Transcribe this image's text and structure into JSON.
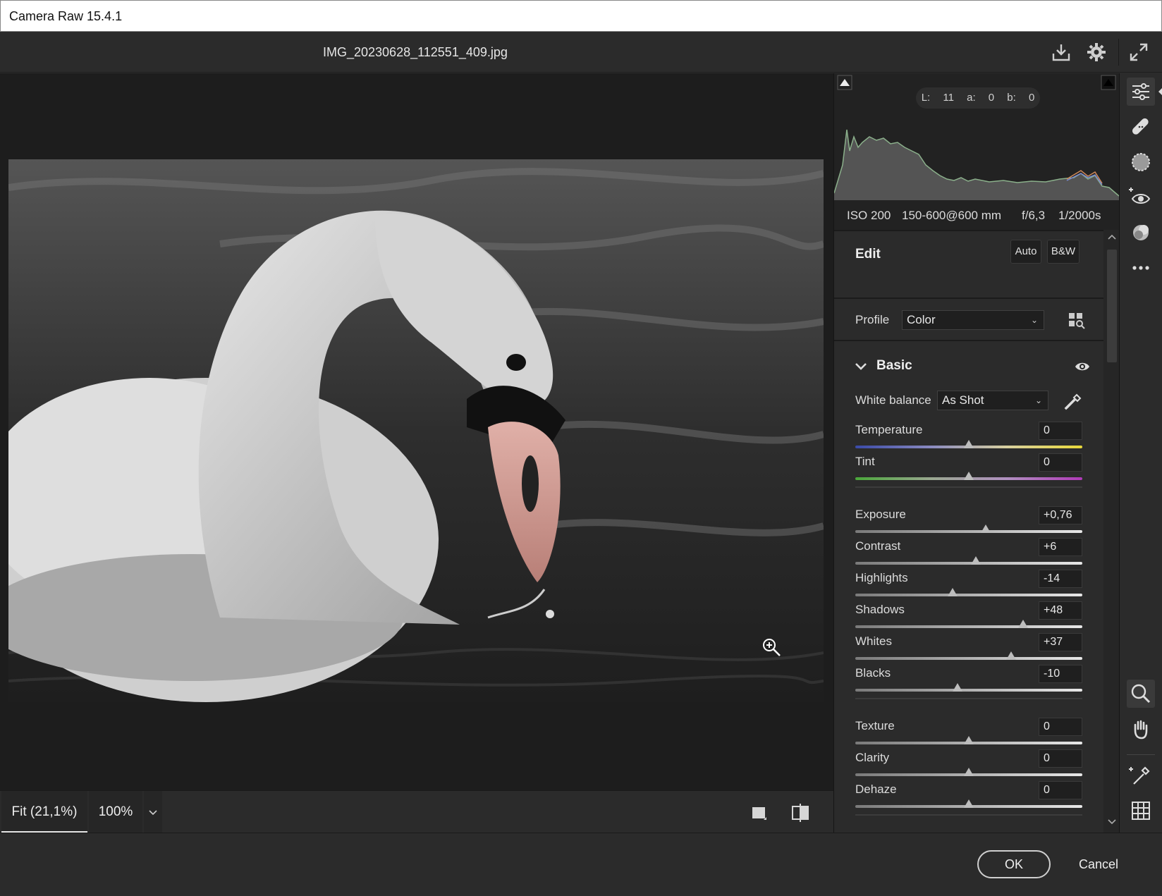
{
  "window": {
    "title": "Camera Raw 15.4.1"
  },
  "header": {
    "filename": "IMG_20230628_112551_409.jpg",
    "icons": [
      "save-icon",
      "settings-gear-icon",
      "fullscreen-icon"
    ]
  },
  "canvas": {
    "zoom_fit_label": "Fit (21,1%)",
    "zoom_100_label": "100%"
  },
  "histogram": {
    "lab_readout": "L: 11   a: 0   b: 0",
    "iso": "ISO 200",
    "lens": "150-600@600 mm",
    "aperture": "f/6,3",
    "shutter": "1/2000s"
  },
  "edit": {
    "title": "Edit",
    "auto_label": "Auto",
    "bw_label": "B&W",
    "profile_label": "Profile",
    "profile_value": "Color"
  },
  "basic": {
    "title": "Basic",
    "white_balance_label": "White balance",
    "white_balance_value": "As Shot",
    "sliders": [
      {
        "label": "Temperature",
        "value": "0",
        "pos": 0.5
      },
      {
        "label": "Tint",
        "value": "0",
        "pos": 0.5
      },
      {
        "label": "Exposure",
        "value": "+0,76",
        "pos": 0.576
      },
      {
        "label": "Contrast",
        "value": "+6",
        "pos": 0.53
      },
      {
        "label": "Highlights",
        "value": "-14",
        "pos": 0.43
      },
      {
        "label": "Shadows",
        "value": "+48",
        "pos": 0.74
      },
      {
        "label": "Whites",
        "value": "+37",
        "pos": 0.685
      },
      {
        "label": "Blacks",
        "value": "-10",
        "pos": 0.45
      },
      {
        "label": "Texture",
        "value": "0",
        "pos": 0.5
      },
      {
        "label": "Clarity",
        "value": "0",
        "pos": 0.5
      },
      {
        "label": "Dehaze",
        "value": "0",
        "pos": 0.5
      }
    ]
  },
  "footer": {
    "ok_label": "OK",
    "cancel_label": "Cancel"
  },
  "tools": [
    "sliders-icon",
    "healing-brush-icon",
    "mask-icon",
    "red-eye-icon",
    "presets-icon",
    "more-icon",
    "zoom-icon",
    "hand-icon",
    "color-sampler-icon",
    "grid-icon"
  ]
}
